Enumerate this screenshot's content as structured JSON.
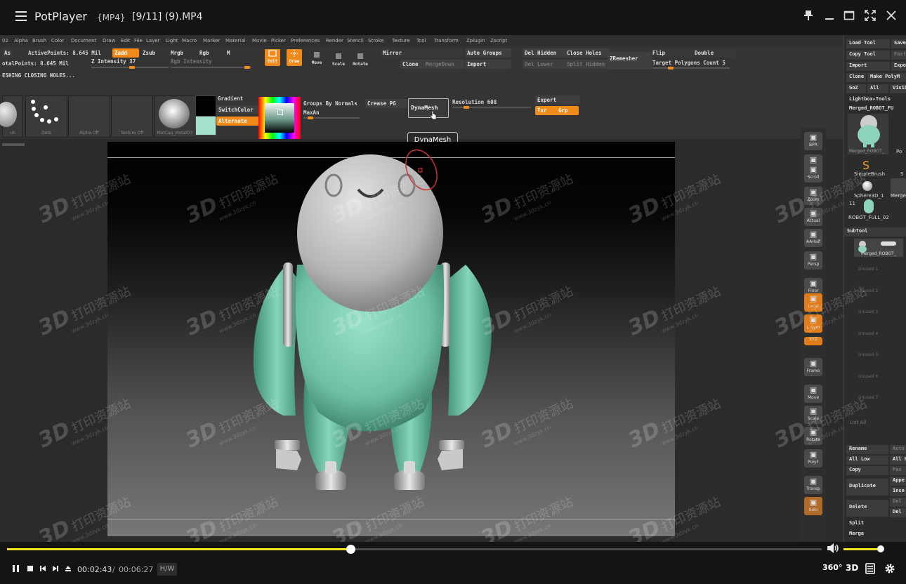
{
  "titlebar": {
    "app_name": "PotPlayer",
    "format": "{MP4}",
    "filename": "[9/11] (9).MP4"
  },
  "zbrush": {
    "menu": [
      "02",
      "Alpha",
      "Brush",
      "Color",
      "Document",
      "Draw",
      "Edit",
      "File",
      "Layer",
      "Light",
      "Macro",
      "Marker",
      "Material",
      "Movie",
      "Picker",
      "Preferences",
      "Render",
      "Stencil",
      "Stroke",
      "Texture",
      "Tool",
      "Transform",
      "Zplugin",
      "Zscript"
    ],
    "row1": {
      "as": "As",
      "active_points": "ActivePoints: 8.645 Mil",
      "total_points": "otalPoints: 8.645 Mil",
      "closing": "ESHING CLOSING HOLES...",
      "zadd": "Zadd",
      "zsub": "Zsub",
      "mrgb": "Mrgb",
      "rgb": "Rgb",
      "m": "M",
      "z_intensity": "Z Intensity 37",
      "rgb_intensity": "Rgb Intensity",
      "edit": "Edit",
      "draw": "Draw",
      "move": "Move",
      "scale": "Scale",
      "rotate": "Rotate",
      "mirror": "Mirror",
      "auto_groups": "Auto Groups",
      "clone": "Clone",
      "merge_down": "MergeDown",
      "import": "Import",
      "del_hidden": "Del Hidden",
      "close_holes": "Close Holes",
      "del_lower": "Del Lower",
      "split_hidden": "Split Hidden",
      "zremesher": "ZRemesher",
      "flip": "Flip",
      "double": "Double",
      "target_polygons": "Target Polygons Count 5"
    },
    "row2": {
      "dots": "Dots",
      "alpha_off": "Alpha Off",
      "texture_off": "Texture Off",
      "matcap": "MatCap_MetalO3",
      "brush_label": "uh",
      "gradient": "Gradient",
      "switch_color": "SwitchColor",
      "alternate": "Alternate",
      "groups_by_normals": "Groups By Normals",
      "crease_pg": "Crease PG",
      "max_an": "MaxAn",
      "dynamesh": "DynaMesh",
      "resolution": "Resolution 608",
      "export": "Export",
      "txr": "Txr",
      "grp": "Grp"
    },
    "tooltip": "DynaMesh",
    "right_strip": [
      {
        "label": "BPR",
        "icon": "bpr-icon"
      },
      {
        "label": "SPix 3",
        "icon": "spix-icon"
      },
      {
        "label": "Scroll",
        "icon": "scroll-icon"
      },
      {
        "label": "Zoom",
        "icon": "zoom-icon"
      },
      {
        "label": "Actual",
        "icon": "actual-icon"
      },
      {
        "label": "AAHalf",
        "icon": "aahalf-icon"
      },
      {
        "label": "Persp",
        "icon": "persp-icon"
      },
      {
        "label": "Floor",
        "icon": "floor-icon"
      },
      {
        "label": "Local",
        "icon": "local-icon"
      },
      {
        "label": "L.Sym",
        "icon": "lsym-icon"
      },
      {
        "label": "XYZ",
        "icon": "xyz-icon"
      },
      {
        "label": "Frame",
        "icon": "frame-icon"
      },
      {
        "label": "Move",
        "icon": "move-icon"
      },
      {
        "label": "Scale",
        "icon": "scale-icon"
      },
      {
        "label": "Rotate",
        "icon": "rotate-icon"
      },
      {
        "label": "PolyF",
        "icon": "polyf-icon"
      },
      {
        "label": "Transp",
        "icon": "transp-icon"
      },
      {
        "label": "Solo",
        "icon": "solo-icon"
      }
    ],
    "tool_panel": {
      "load_tool": "Load Tool",
      "save": "Save",
      "copy_tool": "Copy Tool",
      "paste": "Past",
      "import": "Import",
      "export": "Expo",
      "clone": "Clone",
      "make_polymesh": "Make PolyM",
      "goz": "GoZ",
      "all": "All",
      "visible": "Visib",
      "lightbox_tools": "Lightbox▸Tools",
      "merged_robot": "Merged_ROBOT_FU",
      "thumb_merged": "Merged_ROBOT_",
      "po": "Po",
      "simple_brush": "SimpleBrush",
      "s": "S",
      "sphere3d": "Sphere3D_1",
      "merge": "Merge",
      "eleven": "11",
      "robot_full": "ROBOT_FULL_02",
      "subtool": "SubTool",
      "subtool_item": "Merged_ROBOT_",
      "unused": [
        "Unused 1",
        "Unused 2",
        "Unused 3",
        "Unused 4",
        "Unused 5",
        "Unused 6",
        "Unused 7"
      ],
      "list_all": "List All",
      "rename": "Rename",
      "auto": "Auto",
      "all_low": "All Low",
      "all_high": "All H",
      "copy": "Copy",
      "paste2": "Pas",
      "duplicate": "Duplicate",
      "append": "Appe",
      "insert": "Inse",
      "delete": "Delete",
      "del": "Del",
      "del_all": "Del",
      "split": "Split",
      "merge2": "Merge"
    }
  },
  "watermark": {
    "brand": "3D",
    "text": "打印资源站",
    "url": "www.3dzyk.cn"
  },
  "player": {
    "current_time": "00:02:43",
    "separator": "/",
    "total_time": "00:06:27",
    "progress_fraction": 0.4212,
    "volume_fraction": 0.95,
    "hw_label": "H/W",
    "btn_360": "360°",
    "btn_3d": "3D"
  },
  "colors": {
    "accent_yellow": "#f5e51a",
    "zbrush_orange": "#f08a1a",
    "robot_body": "#7fcfb5",
    "robot_head": "#b7b7b7"
  }
}
